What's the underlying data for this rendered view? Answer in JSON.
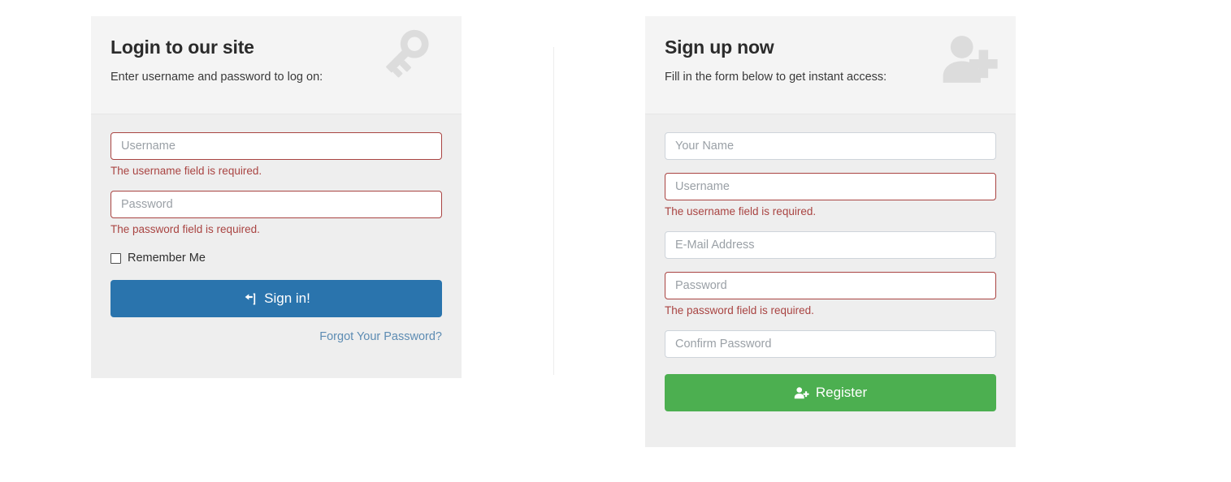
{
  "login_card": {
    "title": "Login to our site",
    "subtitle": "Enter username and password to log on:",
    "header_icon": "key-icon",
    "fields": [
      {
        "name": "username",
        "placeholder": "Username",
        "value": "",
        "invalid": true,
        "error": "The username field is required."
      },
      {
        "name": "password",
        "placeholder": "Password",
        "value": "",
        "invalid": true,
        "error": "The password field is required."
      }
    ],
    "remember_label": "Remember Me",
    "remember_checked": false,
    "submit_label": "Sign in!",
    "submit_icon": "sign-in-icon",
    "submit_color": "#2a74ad",
    "forgot_label": "Forgot Your Password?",
    "forgot_color": "#5d8cb3"
  },
  "signup_card": {
    "title": "Sign up now",
    "subtitle": "Fill in the form below to get instant access:",
    "header_icon": "user-plus-icon",
    "fields": [
      {
        "name": "your-name",
        "placeholder": "Your Name",
        "value": "",
        "invalid": false,
        "error": ""
      },
      {
        "name": "username",
        "placeholder": "Username",
        "value": "",
        "invalid": true,
        "error": "The username field is required."
      },
      {
        "name": "email",
        "placeholder": "E-Mail Address",
        "value": "",
        "invalid": false,
        "error": ""
      },
      {
        "name": "password",
        "placeholder": "Password",
        "value": "",
        "invalid": true,
        "error": "The password field is required."
      },
      {
        "name": "confirm-password",
        "placeholder": "Confirm Password",
        "value": "",
        "invalid": false,
        "error": ""
      }
    ],
    "submit_label": "Register",
    "submit_icon": "user-plus-icon",
    "submit_color": "#4caf50"
  },
  "colors": {
    "page_background": "#ffffff",
    "card_background": "#eeeeee",
    "card_header_background": "#f4f4f4",
    "error": "#a94442",
    "input_border": "#ced4da",
    "divider": "#ececec",
    "header_icon": "#dcdcdc"
  }
}
